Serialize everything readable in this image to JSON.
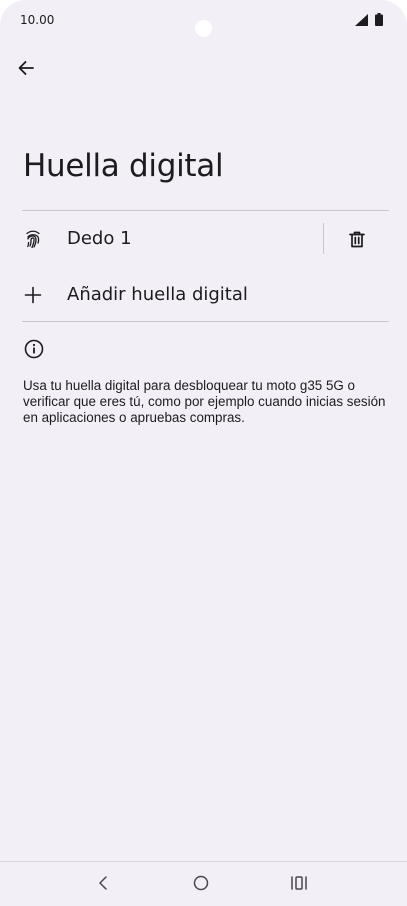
{
  "status_bar": {
    "time": "10.00",
    "icons": [
      "signal-icon",
      "battery-icon"
    ]
  },
  "header": {
    "back_icon": "arrow-left-icon"
  },
  "page": {
    "title": "Huella digital"
  },
  "fingerprints": [
    {
      "label": "Dedo 1",
      "icon": "fingerprint-icon",
      "delete_icon": "trash-icon"
    }
  ],
  "add_fingerprint": {
    "label": "Añadir huella digital",
    "icon": "plus-icon"
  },
  "info": {
    "icon": "info-icon",
    "text": "Usa tu huella digital para desbloquear tu moto g35 5G o verificar que eres tú, como por ejemplo cuando inicias sesión en aplicaciones o apruebas compras."
  },
  "nav_bar": {
    "icons": [
      "back-nav-icon",
      "home-nav-icon",
      "recents-nav-icon"
    ]
  },
  "colors": {
    "background": "#f2eff6",
    "text": "#1c1b1f",
    "divider": "#c9c5ce"
  }
}
